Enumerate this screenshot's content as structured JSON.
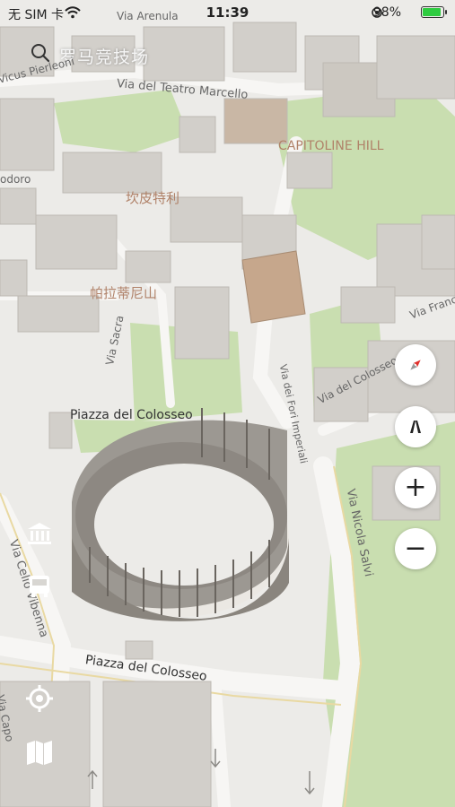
{
  "status_bar": {
    "carrier": "无 SIM 卡",
    "time": "11:39",
    "battery": "98%",
    "battery_level": 0.98
  },
  "search": {
    "query": "罗马竞技场",
    "icon": "search-icon"
  },
  "map_labels": {
    "via_arenula": "Via Arenula",
    "via_pierleoni": "Vicus Pierleoni",
    "via_teatro_marcello": "Via del Teatro Marcello",
    "capitoline_hill": "CAPITOLINE HILL",
    "teodoro": "odoro",
    "campidoglio": "坎皮特利",
    "palatino": "帕拉蒂尼山",
    "via_sacra": "Via Sacra",
    "via_fori_imperiali": "Via dei Fori Imperiali",
    "piazza_colosseo_top": "Piazza del Colosseo",
    "via_colosseo": "Via del Colosseo",
    "via_franca": "Via Franc",
    "via_nicola_salvi": "Via Nicola Salvi",
    "via_celio_vibenna": "Via Celio Vibenna",
    "piazza_colosseo_bottom": "Piazza del Colosseo",
    "via_capo": "Via Capo"
  },
  "controls": {
    "compass": "compass-icon",
    "view_3d": "3d-view-icon",
    "zoom_in": "+",
    "zoom_out": "−"
  },
  "side_icons": {
    "museum": "museum-icon",
    "transit": "bus-icon",
    "locate": "locate-icon",
    "map_layers": "map-layers-icon"
  },
  "colors": {
    "park": "#c9deb0",
    "building": "#d2cfca",
    "road": "#f4f3f1",
    "poi_text": "#b08269",
    "background": "#ecebe8"
  }
}
